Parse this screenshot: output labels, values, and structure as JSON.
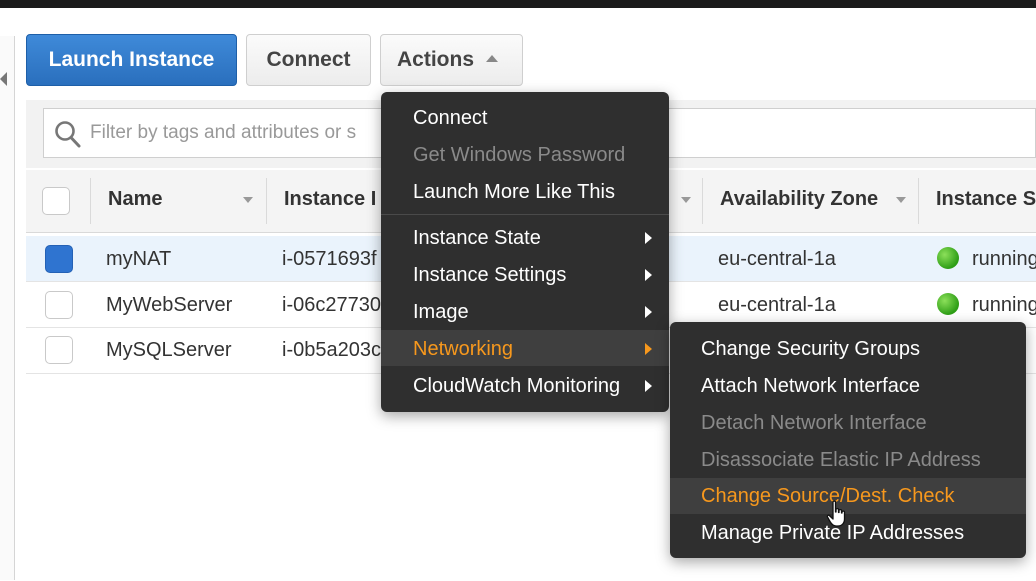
{
  "toolbar": {
    "launch_label": "Launch Instance",
    "connect_label": "Connect",
    "actions_label": "Actions"
  },
  "search": {
    "placeholder": "Filter by tags and attributes or s"
  },
  "table": {
    "columns": [
      "Name",
      "Instance I",
      "Availability Zone",
      "Instance S"
    ],
    "rows": [
      {
        "name": "myNAT",
        "instance_id": "i-0571693f",
        "zone": "eu-central-1a",
        "state": "running",
        "selected": true
      },
      {
        "name": "MyWebServer",
        "instance_id": "i-06c27730",
        "zone": "eu-central-1a",
        "state": "running",
        "selected": false
      },
      {
        "name": "MySQLServer",
        "instance_id": "i-0b5a203c",
        "zone": "",
        "state": "",
        "selected": false
      }
    ]
  },
  "actions_menu": {
    "items": [
      {
        "label": "Connect",
        "state": "enabled"
      },
      {
        "label": "Get Windows Password",
        "state": "disabled"
      },
      {
        "label": "Launch More Like This",
        "state": "enabled"
      },
      {
        "label": "Instance State",
        "state": "enabled",
        "submenu": true
      },
      {
        "label": "Instance Settings",
        "state": "enabled",
        "submenu": true
      },
      {
        "label": "Image",
        "state": "enabled",
        "submenu": true
      },
      {
        "label": "Networking",
        "state": "active",
        "submenu": true
      },
      {
        "label": "CloudWatch Monitoring",
        "state": "enabled",
        "submenu": true
      }
    ]
  },
  "networking_submenu": {
    "items": [
      {
        "label": "Change Security Groups",
        "state": "enabled"
      },
      {
        "label": "Attach Network Interface",
        "state": "enabled"
      },
      {
        "label": "Detach Network Interface",
        "state": "disabled"
      },
      {
        "label": "Disassociate Elastic IP Address",
        "state": "disabled"
      },
      {
        "label": "Change Source/Dest. Check",
        "state": "hover"
      },
      {
        "label": "Manage Private IP Addresses",
        "state": "enabled"
      }
    ]
  },
  "colors": {
    "primary": "#2f78c9",
    "menu_bg": "#2f2f2f",
    "highlight": "#f7981d",
    "running": "#3cb521"
  },
  "icons": [
    "search-icon",
    "chevron-up-icon",
    "chevron-right-icon",
    "status-running-icon",
    "hand-cursor-icon"
  ]
}
